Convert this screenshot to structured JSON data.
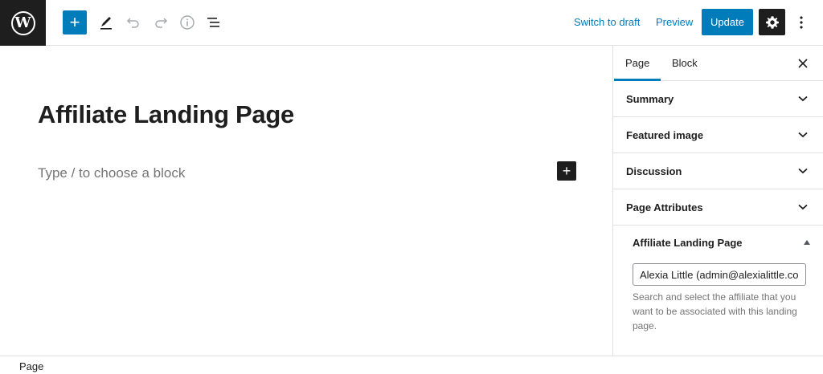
{
  "toolbar": {
    "logo_letter": "W",
    "add_block_glyph": "+",
    "icons": [
      "wordpress-icon",
      "plus-icon",
      "pencil-icon",
      "undo-icon",
      "redo-icon",
      "info-icon",
      "list-view-icon",
      "gear-icon",
      "more-vertical-icon"
    ],
    "switch_to_draft": "Switch to draft",
    "preview": "Preview",
    "update": "Update"
  },
  "editor": {
    "title": "Affiliate Landing Page",
    "block_placeholder": "Type / to choose a block",
    "inline_add_glyph": "+"
  },
  "sidebar": {
    "tabs": [
      {
        "label": "Page",
        "active": true
      },
      {
        "label": "Block",
        "active": false
      }
    ],
    "panels": [
      {
        "label": "Summary"
      },
      {
        "label": "Featured image"
      },
      {
        "label": "Discussion"
      },
      {
        "label": "Page Attributes"
      }
    ],
    "affiliate_panel": {
      "title": "Affiliate Landing Page",
      "input_value": "Alexia Little (admin@alexialittle.com)",
      "help_text": "Search and select the affiliate that you want to be associated with this landing page."
    }
  },
  "footer": {
    "breadcrumb": "Page"
  },
  "colors": {
    "accent": "#007cba",
    "dark": "#1e1e1e",
    "muted": "#757575",
    "border": "#e0e0e0"
  }
}
